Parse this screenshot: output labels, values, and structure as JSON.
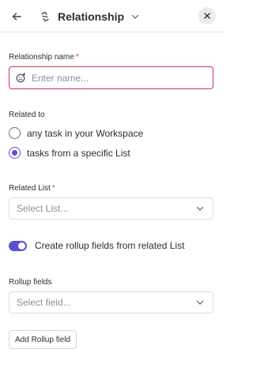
{
  "header": {
    "title": "Relationship",
    "back_icon": "arrow-left-icon",
    "title_icon": "relationship-icon",
    "chevron_icon": "chevron-down-icon",
    "close_icon": "close-icon"
  },
  "name_field": {
    "label": "Relationship name",
    "required_marker": "*",
    "placeholder": "Enter name...",
    "value": "",
    "icon": "emoji-add-icon"
  },
  "related_to": {
    "label": "Related to",
    "options": [
      {
        "label": "any task in your Workspace",
        "checked": false
      },
      {
        "label": "tasks from a specific List",
        "checked": true
      }
    ]
  },
  "related_list": {
    "label": "Related List",
    "required_marker": "*",
    "placeholder": "Select List..."
  },
  "rollup_toggle": {
    "label": "Create rollup fields from related List",
    "enabled": true
  },
  "rollup_fields": {
    "label": "Rollup fields",
    "placeholder": "Select field..."
  },
  "add_rollup_button": {
    "label": "Add Rollup field"
  },
  "colors": {
    "accent": "#5b4fd6",
    "error_border": "#c9384b",
    "required": "#d33a4a"
  }
}
